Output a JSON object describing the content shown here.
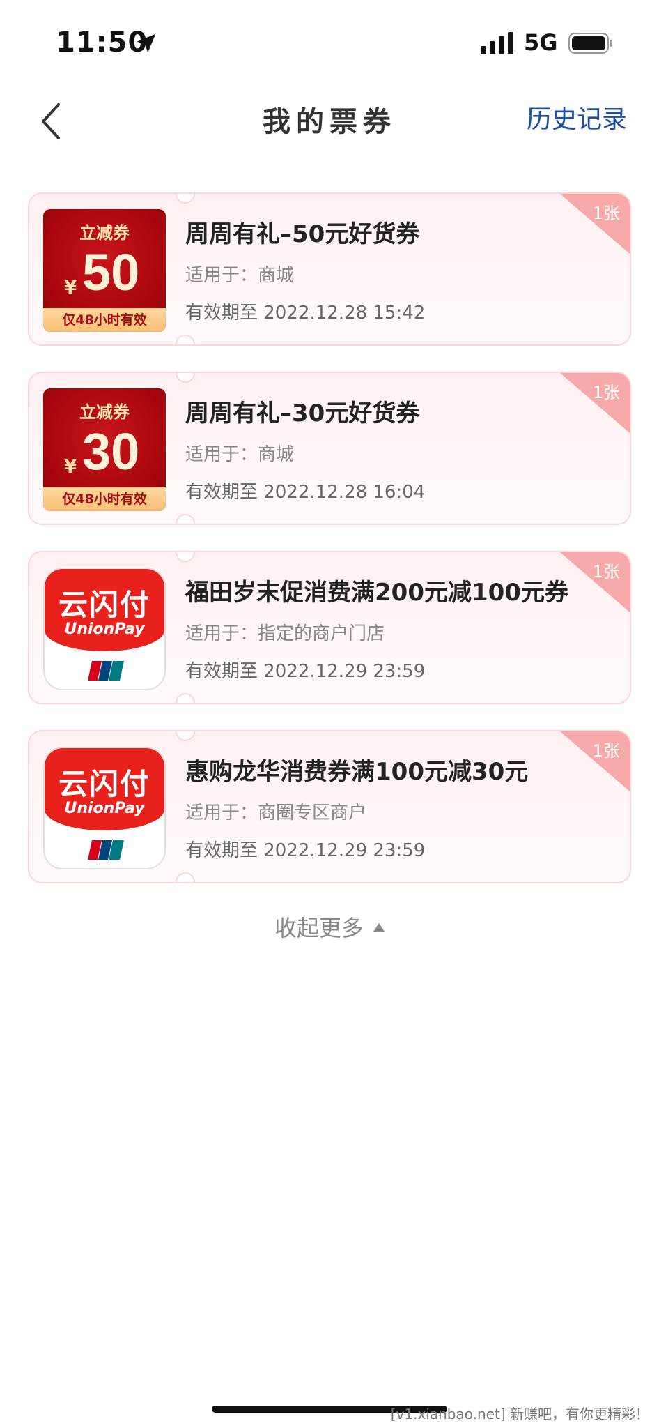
{
  "status_bar": {
    "time": "11:50",
    "network": "5G"
  },
  "header": {
    "title": "我的票券",
    "history": "历史记录"
  },
  "coupons": [
    {
      "thumb": {
        "label": "立减券",
        "yen": "¥",
        "amount": "50",
        "foot": "仅48小时有效"
      },
      "title": "周周有礼–50元好货券",
      "scope": "适用于：商城",
      "expiry": "有效期至 2022.12.28 15:42",
      "badge": "1张"
    },
    {
      "thumb": {
        "label": "立减券",
        "yen": "¥",
        "amount": "30",
        "foot": "仅48小时有效"
      },
      "title": "周周有礼–30元好货券",
      "scope": "适用于：商城",
      "expiry": "有效期至 2022.12.28 16:04",
      "badge": "1张"
    },
    {
      "thumb": {
        "brand": "云闪付",
        "sub": "UnionPay"
      },
      "title": "福田岁末促消费满200元减100元券",
      "scope": "适用于：指定的商户门店",
      "expiry": "有效期至 2022.12.29 23:59",
      "badge": "1张"
    },
    {
      "thumb": {
        "brand": "云闪付",
        "sub": "UnionPay"
      },
      "title": "惠购龙华消费券满100元减30元",
      "scope": "适用于：商圈专区商户",
      "expiry": "有效期至 2022.12.29 23:59",
      "badge": "1张"
    }
  ],
  "collapse": "收起更多",
  "watermark": "[v1.xianbao.net] 新赚吧，有你更精彩！",
  "colors": {
    "accent_link": "#1a4fa3",
    "badge": "#f7a8a8",
    "card_border": "#ffd4d8",
    "unionpay_red": "#e8211c"
  }
}
